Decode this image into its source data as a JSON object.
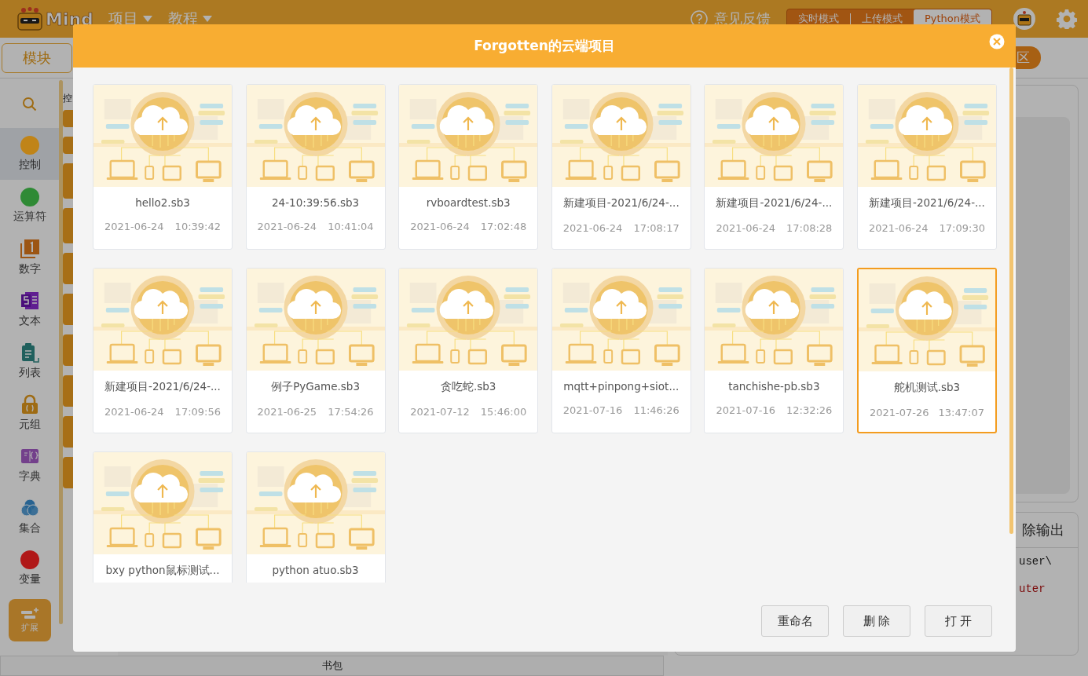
{
  "app": {
    "logo_text": "Mind",
    "menus": [
      {
        "label": "项目"
      },
      {
        "label": "教程"
      }
    ],
    "feedback": "意见反馈",
    "modes": [
      {
        "label": "实时模式",
        "selected": false
      },
      {
        "label": "上传模式",
        "selected": false
      },
      {
        "label": "Python模式",
        "selected": true
      }
    ]
  },
  "module_tab": "模块",
  "stage_pill": "区",
  "palette_heading": "控",
  "categories": [
    {
      "label": "控制",
      "kind": "circle",
      "color": "#c08418",
      "selected": true
    },
    {
      "label": "运算符",
      "kind": "circle",
      "color": "#2f8a35",
      "selected": false
    },
    {
      "label": "数字",
      "kind": "number",
      "selected": false
    },
    {
      "label": "文本",
      "kind": "text",
      "selected": false
    },
    {
      "label": "列表",
      "kind": "list",
      "selected": false
    },
    {
      "label": "元组",
      "kind": "tuple",
      "selected": false
    },
    {
      "label": "字典",
      "kind": "dict",
      "selected": false
    },
    {
      "label": "集合",
      "kind": "set",
      "selected": false
    },
    {
      "label": "变量",
      "kind": "circle",
      "color": "#b01818",
      "selected": false
    }
  ],
  "extension_button": "扩展",
  "output": {
    "header": "除输出",
    "lines": [
      {
        "text": "user\\",
        "kind": "normal"
      },
      {
        "text": "uter",
        "kind": "error"
      }
    ]
  },
  "backpack": "书包",
  "dialog": {
    "title": "Forgotten的云端项目",
    "projects": [
      {
        "name": "hello2.sb3",
        "date": "2021-06-24",
        "time": "10:39:42",
        "selected": false
      },
      {
        "name": "24-10:39:56.sb3",
        "date": "2021-06-24",
        "time": "10:41:04",
        "selected": false
      },
      {
        "name": "rvboardtest.sb3",
        "date": "2021-06-24",
        "time": "17:02:48",
        "selected": false
      },
      {
        "name": "新建项目-2021/6/24-...",
        "date": "2021-06-24",
        "time": "17:08:17",
        "selected": false
      },
      {
        "name": "新建项目-2021/6/24-...",
        "date": "2021-06-24",
        "time": "17:08:28",
        "selected": false
      },
      {
        "name": "新建项目-2021/6/24-...",
        "date": "2021-06-24",
        "time": "17:09:30",
        "selected": false
      },
      {
        "name": "新建项目-2021/6/24-...",
        "date": "2021-06-24",
        "time": "17:09:56",
        "selected": false
      },
      {
        "name": "例子PyGame.sb3",
        "date": "2021-06-25",
        "time": "17:54:26",
        "selected": false
      },
      {
        "name": "贪吃蛇.sb3",
        "date": "2021-07-12",
        "time": "15:46:00",
        "selected": false
      },
      {
        "name": "mqtt+pinpong+siot...",
        "date": "2021-07-16",
        "time": "11:46:26",
        "selected": false
      },
      {
        "name": "tanchishe-pb.sb3",
        "date": "2021-07-16",
        "time": "12:32:26",
        "selected": false
      },
      {
        "name": "舵机测试.sb3",
        "date": "2021-07-26",
        "time": "13:47:07",
        "selected": true
      },
      {
        "name": "bxy python鼠标测试...",
        "selected": false
      },
      {
        "name": "python atuo.sb3",
        "selected": false
      }
    ],
    "buttons": [
      {
        "label": "重命名"
      },
      {
        "label": "删 除"
      },
      {
        "label": "打 开"
      }
    ]
  }
}
